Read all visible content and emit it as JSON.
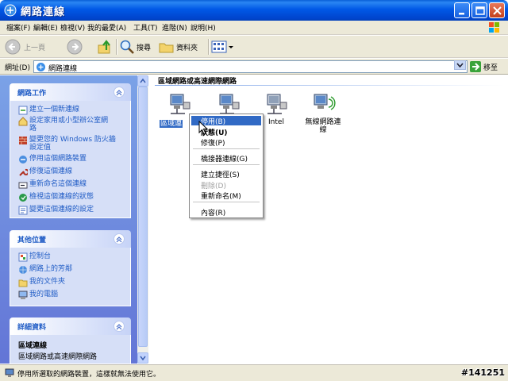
{
  "window": {
    "title": "網路連線"
  },
  "menubar": {
    "items": [
      "檔案(F)",
      "編輯(E)",
      "檢視(V)",
      "我的最愛(A)",
      "工具(T)",
      "進階(N)",
      "說明(H)"
    ]
  },
  "toolbar": {
    "back_label": "上一頁",
    "search_label": "搜尋",
    "folders_label": "資料夾"
  },
  "address": {
    "label": "網址(D)",
    "value": "網路連線",
    "go_label": "移至"
  },
  "tasks_panel": {
    "title": "網路工作",
    "items": [
      "建立一個新連線",
      "設定家用或小型辦公室網",
      "路",
      "變更您的 Windows 防火牆",
      "設定值",
      "停用這個網路裝置",
      "修復這個連線",
      "重新命名這個連線",
      "檢視這個連線的狀態",
      "變更這個連線的設定"
    ]
  },
  "places_panel": {
    "title": "其他位置",
    "items": [
      "控制台",
      "網路上的芳鄰",
      "我的文件夾",
      "我的電腦"
    ]
  },
  "details_panel": {
    "title": "詳細資料",
    "name": "區域連線",
    "type": "區域網路或高速網際網路"
  },
  "main": {
    "group_header": "區域網路或高速網際網路",
    "connections": [
      {
        "label": "區域連"
      },
      {
        "label": ""
      },
      {
        "label": "Intel"
      },
      {
        "label": "無線網路連\n線"
      }
    ]
  },
  "context_menu": {
    "items": [
      "停用(B)",
      "狀態(U)",
      "修復(P)",
      "橋接器連線(G)",
      "建立捷徑(S)",
      "刪除(D)",
      "重新命名(M)",
      "內容(R)"
    ]
  },
  "statusbar": {
    "text": "停用所選取的網路裝置，這樣就無法使用它。",
    "watermark": "#141251"
  },
  "colors": {
    "title_blue": "#0054e3",
    "left_pane": "#6e8fe0",
    "selection": "#316ac5",
    "task_link": "#215dc6"
  },
  "icons": [
    "network-connections-icon",
    "minimize-icon",
    "maximize-icon",
    "close-icon",
    "windows-logo-icon",
    "back-arrow-icon",
    "forward-arrow-icon",
    "up-folder-icon",
    "search-icon",
    "folders-icon",
    "views-icon",
    "go-arrow-icon",
    "network-adapter-icon",
    "wireless-adapter-icon",
    "cursor-icon"
  ]
}
